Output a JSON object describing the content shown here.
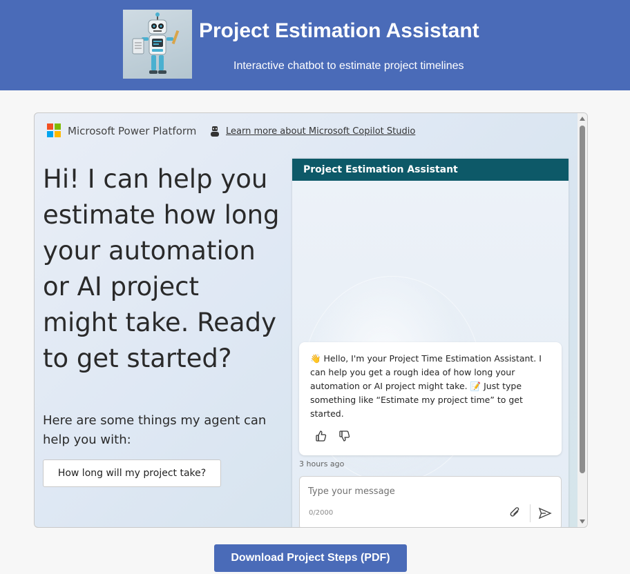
{
  "header": {
    "title": "Project Estimation Assistant",
    "subtitle": "Interactive chatbot to estimate project timelines",
    "logo_icon": "robot-icon"
  },
  "frame": {
    "platform_name": "Microsoft Power Platform",
    "learn_link": "Learn more about Microsoft Copilot Studio",
    "hero": "Hi! I can help you estimate how long your automation or AI project might take. Ready to get started?",
    "helper": "Here are some things my agent can help you with:",
    "suggested_prompt": "How long will my project take?",
    "scroll_position": 0
  },
  "chat": {
    "title": "Project Estimation Assistant",
    "message": "👋 Hello, I'm your Project Time Estimation Assistant. I can help you get a rough idea of how long your automation or AI project might take. 📝 Just type something like “Estimate my project time” to get started.",
    "timestamp": "3 hours ago",
    "input_placeholder": "Type your message",
    "char_count": "0/2000"
  },
  "download_label": "Download Project Steps (PDF)",
  "colors": {
    "header_bg": "#4a6bb8",
    "chat_header_bg": "#0d5968",
    "ms_red": "#f25022",
    "ms_green": "#7fba00",
    "ms_blue": "#00a4ef",
    "ms_yellow": "#ffb900"
  }
}
